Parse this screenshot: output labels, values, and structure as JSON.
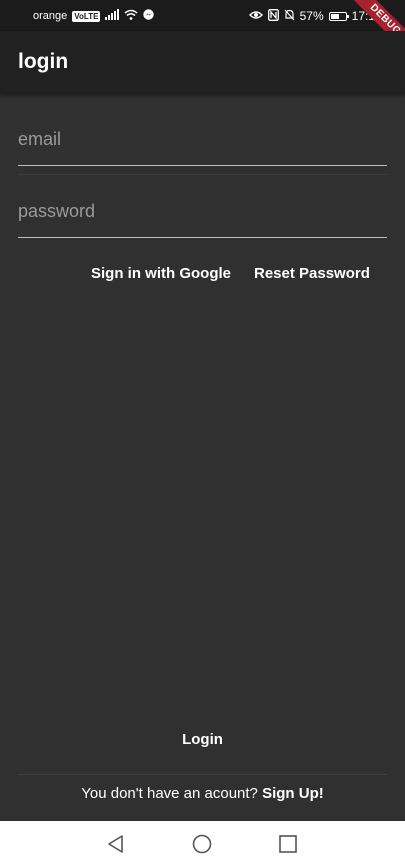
{
  "status_bar": {
    "carrier": "orange",
    "volte": "VoLTE",
    "battery_percent": "57%",
    "battery_level": 0.57,
    "time": "17:1"
  },
  "debug_banner": "DEBUG",
  "app_bar": {
    "title": "login"
  },
  "form": {
    "email_placeholder": "email",
    "password_placeholder": "password"
  },
  "actions": {
    "google_label": "Sign in with Google",
    "reset_label": "Reset Password",
    "login_label": "Login"
  },
  "signup": {
    "prompt": "You don't have an acount?",
    "link": "Sign Up!"
  },
  "nav_bar": {
    "items": [
      "back-icon",
      "home-icon",
      "recents-icon"
    ]
  },
  "colors": {
    "background": "#303030",
    "app_bar": "#212121",
    "status_bar": "#1b1b1b",
    "debug_banner": "#a4232f",
    "text": "#ffffff",
    "placeholder": "#9a9a9a"
  }
}
